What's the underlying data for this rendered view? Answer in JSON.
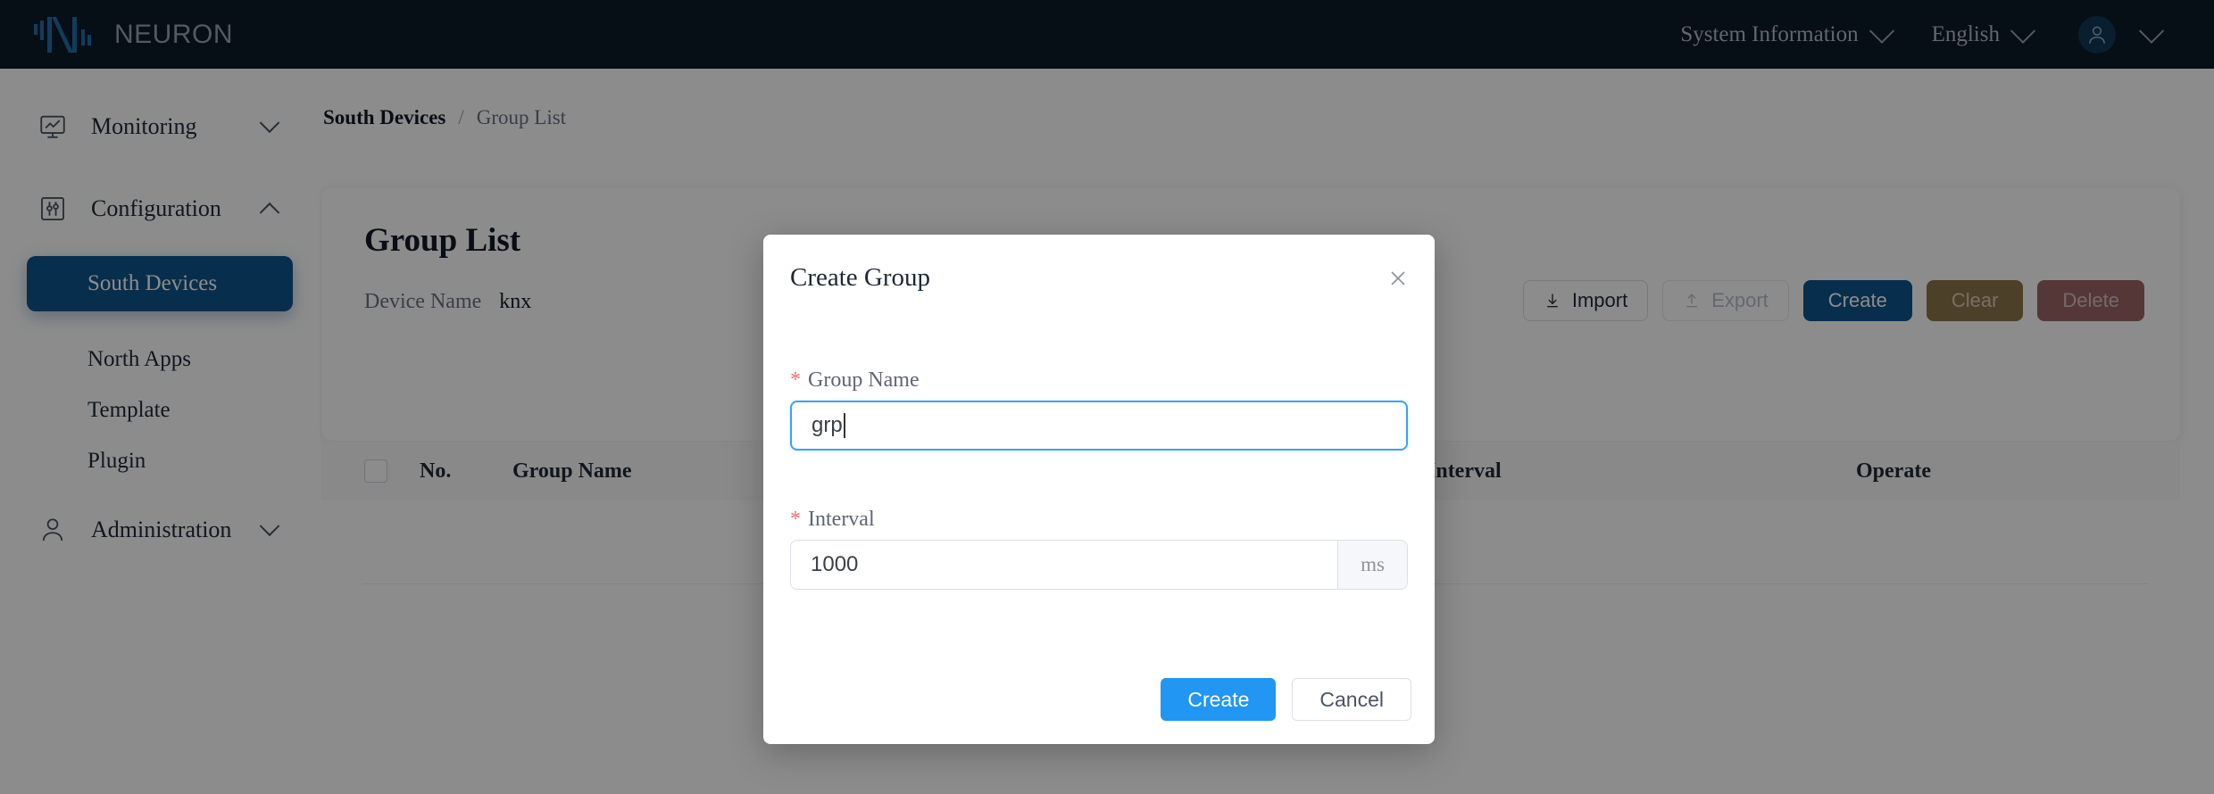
{
  "header": {
    "brand": "NEURON",
    "logo_icon": "neuron-logo-icon",
    "system_information": "System Information",
    "language": "English",
    "user_icon": "user-avatar-icon"
  },
  "sidebar": {
    "groups": [
      {
        "label": "Monitoring",
        "icon": "monitor-chart-icon",
        "expanded": false
      },
      {
        "label": "Configuration",
        "icon": "sliders-icon",
        "expanded": true
      },
      {
        "label": "Administration",
        "icon": "user-icon",
        "expanded": false
      }
    ],
    "config_children": [
      {
        "label": "South Devices",
        "active": true
      },
      {
        "label": "North Apps",
        "active": false
      },
      {
        "label": "Template",
        "active": false
      },
      {
        "label": "Plugin",
        "active": false
      }
    ]
  },
  "breadcrumb": {
    "parent": "South Devices",
    "separator": "/",
    "current": "Group List"
  },
  "page": {
    "title": "Group List",
    "device_name_label": "Device Name",
    "device_name_value": "knx"
  },
  "toolbar": {
    "import": "Import",
    "import_icon": "download-icon",
    "export": "Export",
    "export_icon": "upload-icon",
    "create": "Create",
    "clear": "Clear",
    "delete": "Delete"
  },
  "table": {
    "columns": [
      "No.",
      "Group Name",
      "Interval",
      "Operate"
    ],
    "select_all_icon": "checkbox-icon",
    "rows": []
  },
  "modal": {
    "title": "Create Group",
    "close_icon": "close-icon",
    "required_mark": "*",
    "group_name_label": "Group Name",
    "group_name_value": "grp",
    "interval_label": "Interval",
    "interval_value": "1000",
    "interval_unit": "ms",
    "create_button": "Create",
    "cancel_button": "Cancel"
  },
  "colors": {
    "brand_dark": "#0b1a28",
    "accent_blue": "#10558c",
    "modal_primary": "#2196f3",
    "focus_blue": "#3fa0f0",
    "required_red": "#f56c6c",
    "warn": "#8d7549",
    "danger": "#9c6566"
  }
}
